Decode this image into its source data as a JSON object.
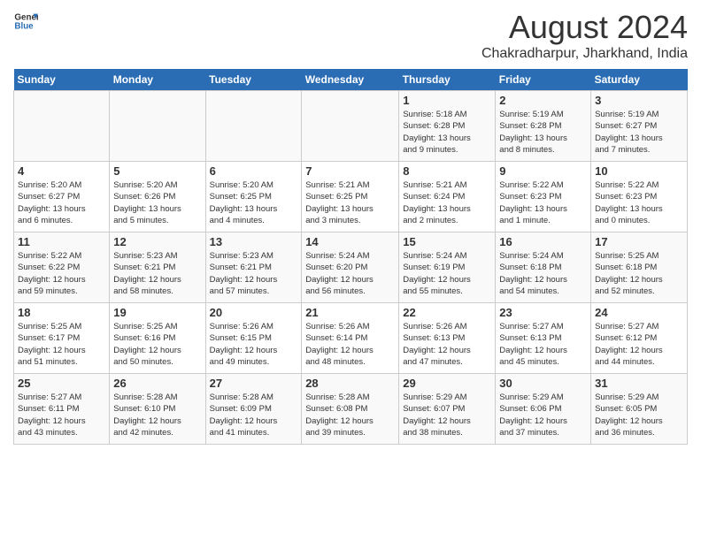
{
  "logo": {
    "line1": "General",
    "line2": "Blue"
  },
  "title": "August 2024",
  "subtitle": "Chakradharpur, Jharkhand, India",
  "days_of_week": [
    "Sunday",
    "Monday",
    "Tuesday",
    "Wednesday",
    "Thursday",
    "Friday",
    "Saturday"
  ],
  "weeks": [
    [
      {
        "day": "",
        "info": ""
      },
      {
        "day": "",
        "info": ""
      },
      {
        "day": "",
        "info": ""
      },
      {
        "day": "",
        "info": ""
      },
      {
        "day": "1",
        "info": "Sunrise: 5:18 AM\nSunset: 6:28 PM\nDaylight: 13 hours\nand 9 minutes."
      },
      {
        "day": "2",
        "info": "Sunrise: 5:19 AM\nSunset: 6:28 PM\nDaylight: 13 hours\nand 8 minutes."
      },
      {
        "day": "3",
        "info": "Sunrise: 5:19 AM\nSunset: 6:27 PM\nDaylight: 13 hours\nand 7 minutes."
      }
    ],
    [
      {
        "day": "4",
        "info": "Sunrise: 5:20 AM\nSunset: 6:27 PM\nDaylight: 13 hours\nand 6 minutes."
      },
      {
        "day": "5",
        "info": "Sunrise: 5:20 AM\nSunset: 6:26 PM\nDaylight: 13 hours\nand 5 minutes."
      },
      {
        "day": "6",
        "info": "Sunrise: 5:20 AM\nSunset: 6:25 PM\nDaylight: 13 hours\nand 4 minutes."
      },
      {
        "day": "7",
        "info": "Sunrise: 5:21 AM\nSunset: 6:25 PM\nDaylight: 13 hours\nand 3 minutes."
      },
      {
        "day": "8",
        "info": "Sunrise: 5:21 AM\nSunset: 6:24 PM\nDaylight: 13 hours\nand 2 minutes."
      },
      {
        "day": "9",
        "info": "Sunrise: 5:22 AM\nSunset: 6:23 PM\nDaylight: 13 hours\nand 1 minute."
      },
      {
        "day": "10",
        "info": "Sunrise: 5:22 AM\nSunset: 6:23 PM\nDaylight: 13 hours\nand 0 minutes."
      }
    ],
    [
      {
        "day": "11",
        "info": "Sunrise: 5:22 AM\nSunset: 6:22 PM\nDaylight: 12 hours\nand 59 minutes."
      },
      {
        "day": "12",
        "info": "Sunrise: 5:23 AM\nSunset: 6:21 PM\nDaylight: 12 hours\nand 58 minutes."
      },
      {
        "day": "13",
        "info": "Sunrise: 5:23 AM\nSunset: 6:21 PM\nDaylight: 12 hours\nand 57 minutes."
      },
      {
        "day": "14",
        "info": "Sunrise: 5:24 AM\nSunset: 6:20 PM\nDaylight: 12 hours\nand 56 minutes."
      },
      {
        "day": "15",
        "info": "Sunrise: 5:24 AM\nSunset: 6:19 PM\nDaylight: 12 hours\nand 55 minutes."
      },
      {
        "day": "16",
        "info": "Sunrise: 5:24 AM\nSunset: 6:18 PM\nDaylight: 12 hours\nand 54 minutes."
      },
      {
        "day": "17",
        "info": "Sunrise: 5:25 AM\nSunset: 6:18 PM\nDaylight: 12 hours\nand 52 minutes."
      }
    ],
    [
      {
        "day": "18",
        "info": "Sunrise: 5:25 AM\nSunset: 6:17 PM\nDaylight: 12 hours\nand 51 minutes."
      },
      {
        "day": "19",
        "info": "Sunrise: 5:25 AM\nSunset: 6:16 PM\nDaylight: 12 hours\nand 50 minutes."
      },
      {
        "day": "20",
        "info": "Sunrise: 5:26 AM\nSunset: 6:15 PM\nDaylight: 12 hours\nand 49 minutes."
      },
      {
        "day": "21",
        "info": "Sunrise: 5:26 AM\nSunset: 6:14 PM\nDaylight: 12 hours\nand 48 minutes."
      },
      {
        "day": "22",
        "info": "Sunrise: 5:26 AM\nSunset: 6:13 PM\nDaylight: 12 hours\nand 47 minutes."
      },
      {
        "day": "23",
        "info": "Sunrise: 5:27 AM\nSunset: 6:13 PM\nDaylight: 12 hours\nand 45 minutes."
      },
      {
        "day": "24",
        "info": "Sunrise: 5:27 AM\nSunset: 6:12 PM\nDaylight: 12 hours\nand 44 minutes."
      }
    ],
    [
      {
        "day": "25",
        "info": "Sunrise: 5:27 AM\nSunset: 6:11 PM\nDaylight: 12 hours\nand 43 minutes."
      },
      {
        "day": "26",
        "info": "Sunrise: 5:28 AM\nSunset: 6:10 PM\nDaylight: 12 hours\nand 42 minutes."
      },
      {
        "day": "27",
        "info": "Sunrise: 5:28 AM\nSunset: 6:09 PM\nDaylight: 12 hours\nand 41 minutes."
      },
      {
        "day": "28",
        "info": "Sunrise: 5:28 AM\nSunset: 6:08 PM\nDaylight: 12 hours\nand 39 minutes."
      },
      {
        "day": "29",
        "info": "Sunrise: 5:29 AM\nSunset: 6:07 PM\nDaylight: 12 hours\nand 38 minutes."
      },
      {
        "day": "30",
        "info": "Sunrise: 5:29 AM\nSunset: 6:06 PM\nDaylight: 12 hours\nand 37 minutes."
      },
      {
        "day": "31",
        "info": "Sunrise: 5:29 AM\nSunset: 6:05 PM\nDaylight: 12 hours\nand 36 minutes."
      }
    ]
  ]
}
